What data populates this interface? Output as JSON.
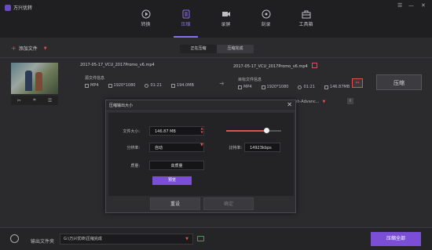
{
  "app": {
    "title": "万兴优转"
  },
  "window": {
    "menu_icon": "☰",
    "minimize_icon": "—",
    "close_icon": "✕"
  },
  "nav": [
    {
      "label": "转换",
      "icon": "play-icon",
      "active": false
    },
    {
      "label": "压缩",
      "icon": "compress-icon",
      "active": true
    },
    {
      "label": "录屏",
      "icon": "record-icon",
      "active": false
    },
    {
      "label": "刻录",
      "icon": "burn-icon",
      "active": false
    },
    {
      "label": "工具箱",
      "icon": "toolbox-icon",
      "active": false
    }
  ],
  "toolbar": {
    "add_file_label": "添加文件",
    "subtabs": [
      {
        "label": "正在压缩",
        "active": true
      },
      {
        "label": "压缩完成",
        "active": false
      }
    ]
  },
  "file": {
    "source_name": "2017-05-17_VCU_2017Promo_v6.mp4",
    "source_info_label": "源文件信息",
    "source_meta": {
      "format": "MP4",
      "resolution": "1920*1080",
      "duration": "01:21",
      "size": "194.0MB"
    },
    "target_name": "2017-05-17_VCU_2017Promo_v6.mp4",
    "target_info_label": "目标文件信息",
    "target_meta": {
      "format": "MP4",
      "resolution": "1920*1080",
      "duration": "01:21",
      "size": "146.87MB"
    },
    "compress_label": "压缩",
    "preset_label": "lish-Advanc..."
  },
  "dialog": {
    "title": "压缩输出大小",
    "size_label": "文件大小:",
    "size_value": "146.87 MB",
    "slider_level": 0.73,
    "resolution_label": "分辨率:",
    "resolution_value": "自动",
    "bitrate_label": "比特率:",
    "bitrate_value": "14923kbps",
    "quality_label": "质量:",
    "quality_value": "高质量",
    "preview_label": "预览",
    "reset_label": "重设",
    "ok_label": "确定"
  },
  "bottom": {
    "output_label": "输出文件夹",
    "output_path": "G:\\万兴优转\\压缩完成",
    "compress_all_label": "压缩全部"
  },
  "colors": {
    "accent": "#7a4fd6",
    "active_nav": "#8b6ef0",
    "red": "#e05050"
  }
}
